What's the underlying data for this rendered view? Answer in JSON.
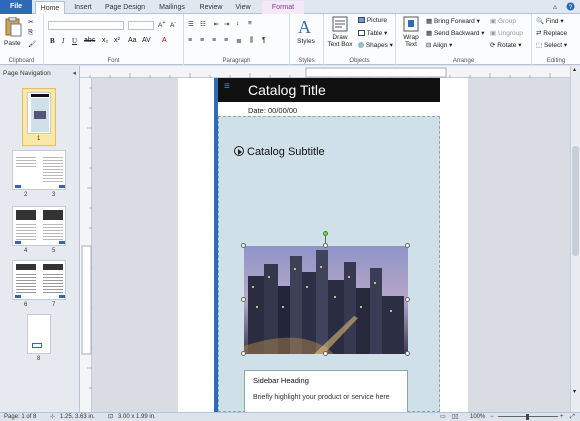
{
  "tabs": [
    "File",
    "Home",
    "Insert",
    "Page Design",
    "Mailings",
    "Review",
    "View",
    "Format"
  ],
  "ribbon": {
    "clipboard": {
      "paste": "Paste",
      "label": "Clipboard"
    },
    "font": {
      "label": "Font",
      "size_value": ""
    },
    "paragraph": {
      "label": "Paragraph"
    },
    "styles": {
      "button": "Styles",
      "label": "Styles"
    },
    "objects": {
      "draw_text_box": "Draw\nText Box",
      "picture": "Picture",
      "table": "Table",
      "shapes": "Shapes",
      "label": "Objects"
    },
    "arrange": {
      "wrap_text": "Wrap\nText",
      "bring_forward": "Bring Forward",
      "send_backward": "Send Backward",
      "align": "Align",
      "group": "Group",
      "ungroup": "Ungroup",
      "rotate": "Rotate",
      "label": "Arrange"
    },
    "editing": {
      "find": "Find",
      "replace": "Replace",
      "select": "Select",
      "label": "Editing"
    }
  },
  "nav": {
    "title": "Page Navigation",
    "pages": [
      "1",
      "2",
      "3",
      "4",
      "5",
      "6",
      "7",
      "8"
    ]
  },
  "document": {
    "title": "Catalog Title",
    "date": "Date: 00/00/00",
    "subtitle": "Catalog Subtitle",
    "sidebar_heading": "Sidebar Heading",
    "sidebar_text": "Briefly highlight your product or service here"
  },
  "status": {
    "page": "Page: 1 of 8",
    "position": "1.25, 3.63 in.",
    "size": "3.00 x 1.99 in.",
    "zoom": "100%"
  }
}
